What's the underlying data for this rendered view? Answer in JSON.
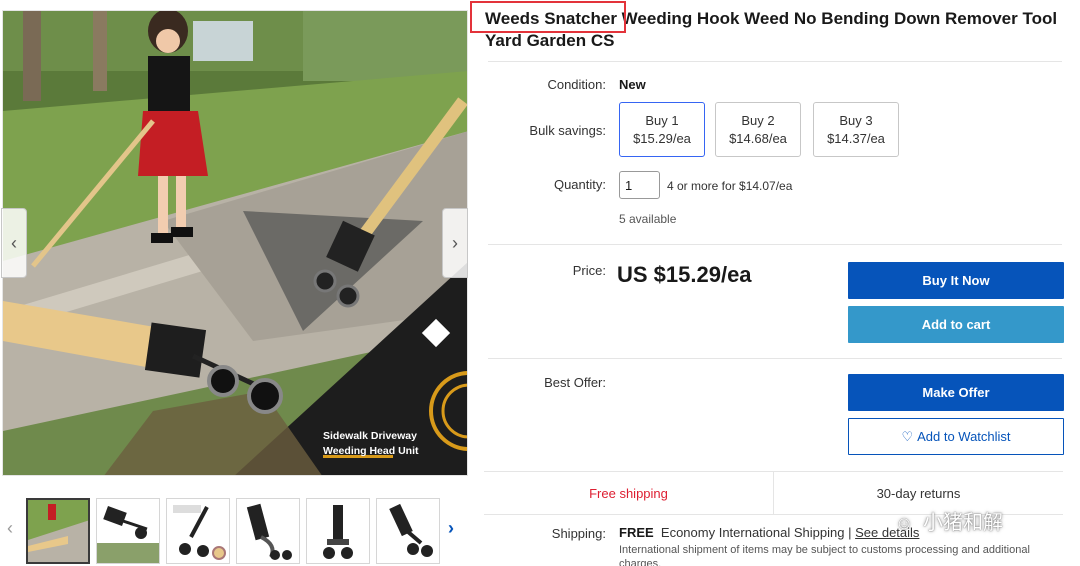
{
  "product": {
    "title": "Weeds Snatcher Weeding Hook Weed No Bending Down Remover Tool Yard Garden CS"
  },
  "gallery": {
    "promo_line1": "Sidewalk Driveway",
    "promo_line2": "Weeding Head Unit",
    "prev_icon": "chevron-left-icon",
    "next_icon": "chevron-right-icon",
    "thumb_count": 6
  },
  "condition": {
    "label": "Condition:",
    "value": "New"
  },
  "bulk": {
    "label": "Bulk savings:",
    "options": [
      {
        "qty": "Buy 1",
        "price": "$15.29/ea"
      },
      {
        "qty": "Buy 2",
        "price": "$14.68/ea"
      },
      {
        "qty": "Buy 3",
        "price": "$14.37/ea"
      }
    ]
  },
  "quantity": {
    "label": "Quantity:",
    "value": "1",
    "note": "4 or more for $14.07/ea",
    "available": "5 available"
  },
  "price": {
    "label": "Price:",
    "value": "US $15.29/ea"
  },
  "actions": {
    "buy_now": "Buy It Now",
    "add_to_cart": "Add to cart",
    "make_offer": "Make Offer",
    "watchlist": "Add to Watchlist"
  },
  "best_offer": {
    "label": "Best Offer:"
  },
  "strip": {
    "free_shipping": "Free shipping",
    "returns": "30-day returns"
  },
  "shipping": {
    "label": "Shipping:",
    "free": "FREE",
    "method": "Economy International Shipping |",
    "details_link": "See details",
    "note": "International shipment of items may be subject to customs processing and additional charges."
  },
  "watermark": {
    "text": "小猪和解"
  },
  "colors": {
    "primary_blue": "#0654ba",
    "cart_blue": "#3498ca",
    "free_shipping_red": "#dd1e31",
    "highlight_red": "#e3333a"
  }
}
